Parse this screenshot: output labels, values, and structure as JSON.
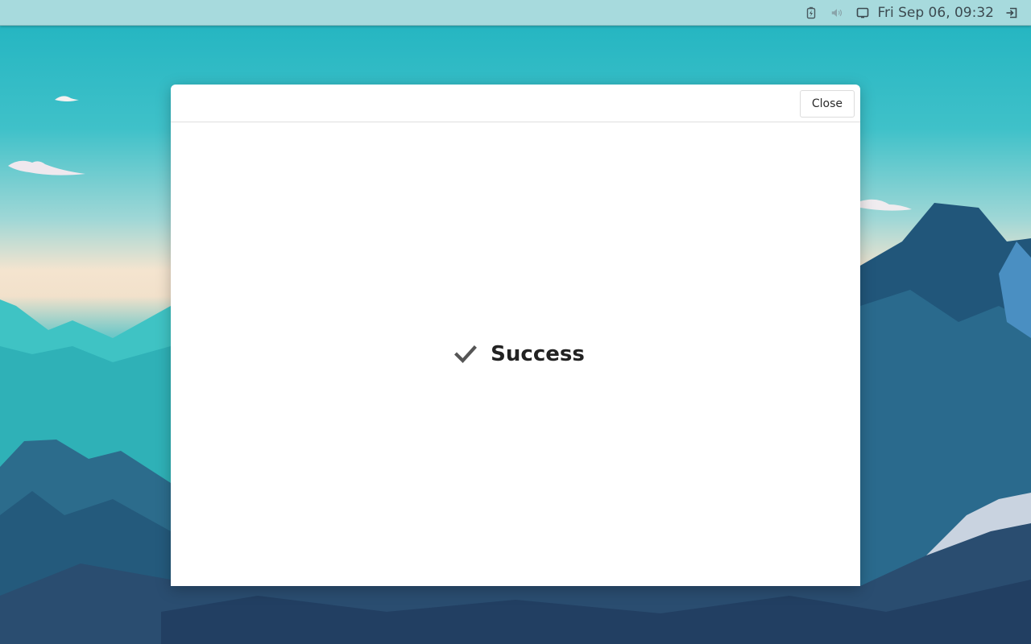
{
  "topbar": {
    "clock": "Fri Sep 06, 09:32",
    "icons": [
      "battery-icon",
      "volume-icon",
      "display-icon",
      "logout-icon"
    ]
  },
  "dialog": {
    "close_label": "Close",
    "message": "Success",
    "message_icon": "check-icon"
  },
  "colors": {
    "topbar_bg": "#a7dadd",
    "dialog_bg": "#ffffff",
    "text": "#222222",
    "check": "#555555"
  }
}
